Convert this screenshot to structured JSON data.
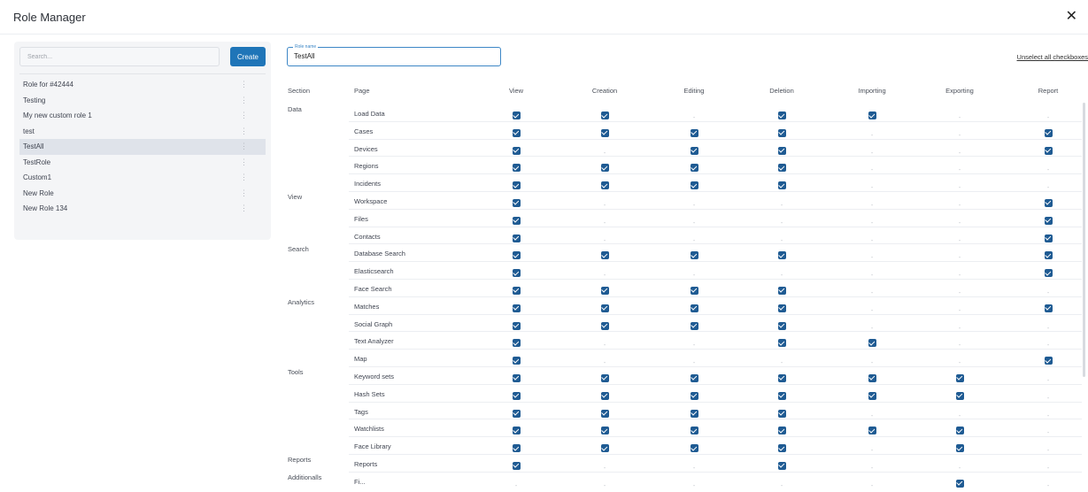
{
  "window": {
    "title": "Role Manager",
    "close_glyph": "✕"
  },
  "sidebar": {
    "search_placeholder": "Search...",
    "create_label": "Create",
    "roles": [
      "Role for #42444",
      "Testing",
      "My new custom role 1",
      "test",
      "TestAll",
      "TestRole",
      "Custom1",
      "New Role",
      "New Role 134"
    ],
    "selected_role": "TestAll"
  },
  "form": {
    "role_name_label": "Role name",
    "role_name_value": "TestAll",
    "unselect_all_label": "Unselect all checkboxes"
  },
  "table": {
    "headers": {
      "section": "Section",
      "page": "Page",
      "view": "View",
      "creation": "Creation",
      "editing": "Editing",
      "deletion": "Deletion",
      "importing": "Importing",
      "exporting": "Exporting",
      "report": "Report"
    },
    "rows": [
      {
        "section": "Data",
        "page": "Load Data",
        "perms": [
          1,
          1,
          0,
          1,
          1,
          0,
          0
        ]
      },
      {
        "section": "",
        "page": "Cases",
        "perms": [
          1,
          1,
          1,
          1,
          0,
          0,
          1
        ]
      },
      {
        "section": "",
        "page": "Devices",
        "perms": [
          1,
          0,
          1,
          1,
          0,
          0,
          1
        ]
      },
      {
        "section": "",
        "page": "Regions",
        "perms": [
          1,
          1,
          1,
          1,
          0,
          0,
          0
        ]
      },
      {
        "section": "",
        "page": "Incidents",
        "perms": [
          1,
          1,
          1,
          1,
          0,
          0,
          0
        ]
      },
      {
        "section": "View",
        "page": "Workspace",
        "perms": [
          1,
          0,
          0,
          0,
          0,
          0,
          1
        ]
      },
      {
        "section": "",
        "page": "Files",
        "perms": [
          1,
          0,
          0,
          0,
          0,
          0,
          1
        ]
      },
      {
        "section": "",
        "page": "Contacts",
        "perms": [
          1,
          0,
          0,
          0,
          0,
          0,
          1
        ]
      },
      {
        "section": "Search",
        "page": "Database Search",
        "perms": [
          1,
          1,
          1,
          1,
          0,
          0,
          1
        ]
      },
      {
        "section": "",
        "page": "Elasticsearch",
        "perms": [
          1,
          0,
          0,
          0,
          0,
          0,
          1
        ]
      },
      {
        "section": "",
        "page": "Face Search",
        "perms": [
          1,
          1,
          1,
          1,
          0,
          0,
          0
        ]
      },
      {
        "section": "Analytics",
        "page": "Matches",
        "perms": [
          1,
          1,
          1,
          1,
          0,
          0,
          1
        ]
      },
      {
        "section": "",
        "page": "Social Graph",
        "perms": [
          1,
          1,
          1,
          1,
          0,
          0,
          0
        ]
      },
      {
        "section": "",
        "page": "Text Analyzer",
        "perms": [
          1,
          0,
          0,
          1,
          1,
          0,
          0
        ]
      },
      {
        "section": "",
        "page": "Map",
        "perms": [
          1,
          0,
          0,
          0,
          0,
          0,
          1
        ]
      },
      {
        "section": "Tools",
        "page": "Keyword sets",
        "perms": [
          1,
          1,
          1,
          1,
          1,
          1,
          0
        ]
      },
      {
        "section": "",
        "page": "Hash Sets",
        "perms": [
          1,
          1,
          1,
          1,
          1,
          1,
          0
        ]
      },
      {
        "section": "",
        "page": "Tags",
        "perms": [
          1,
          1,
          1,
          1,
          0,
          0,
          0
        ]
      },
      {
        "section": "",
        "page": "Watchlists",
        "perms": [
          1,
          1,
          1,
          1,
          1,
          1,
          0
        ]
      },
      {
        "section": "",
        "page": "Face Library",
        "perms": [
          1,
          1,
          1,
          1,
          0,
          1,
          0
        ]
      },
      {
        "section": "Reports",
        "page": "Reports",
        "perms": [
          1,
          0,
          0,
          1,
          0,
          0,
          0
        ]
      },
      {
        "section": "Additionalls",
        "page": "Fi...",
        "perms": [
          0,
          0,
          0,
          0,
          0,
          1,
          0
        ]
      }
    ]
  }
}
